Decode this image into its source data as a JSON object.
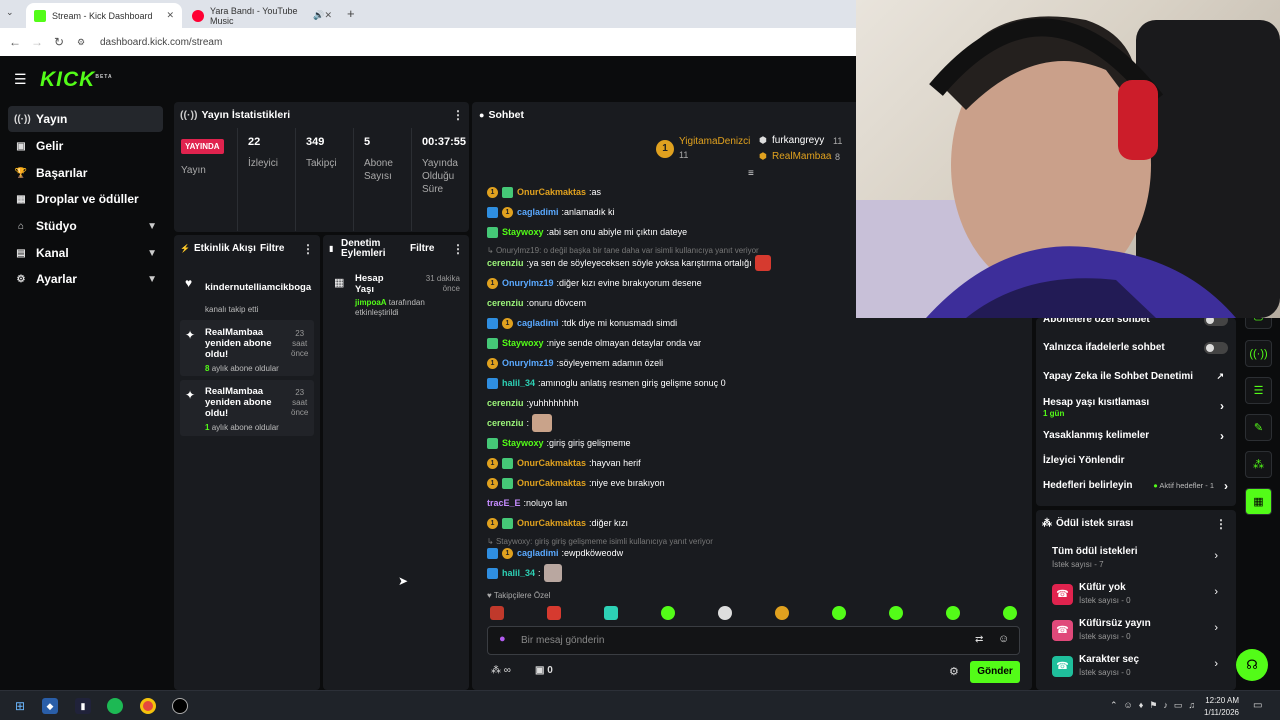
{
  "browser": {
    "tabs": [
      {
        "title": "Stream - Kick Dashboard",
        "favicon_color": "#53fc18"
      },
      {
        "title": "Yara Bandı - YouTube Music",
        "favicon_color": "#ff0033"
      }
    ],
    "url": "dashboard.kick.com/stream"
  },
  "app": {
    "logo": "KICK",
    "logo_tag": "BETA"
  },
  "sidebar": {
    "items": [
      {
        "label": "Yayın",
        "icon": "broadcast-icon"
      },
      {
        "label": "Gelir",
        "icon": "dollar-icon"
      },
      {
        "label": "Başarılar",
        "icon": "trophy-icon"
      },
      {
        "label": "Droplar ve ödüller",
        "icon": "gift-icon"
      },
      {
        "label": "Stüdyo",
        "icon": "studio-icon"
      },
      {
        "label": "Kanal",
        "icon": "channel-icon"
      },
      {
        "label": "Ayarlar",
        "icon": "gear-icon"
      }
    ]
  },
  "stats": {
    "title": "Yayın İstatistikleri",
    "live_badge": "YAYINDA",
    "status_label": "Yayın",
    "viewers": {
      "value": "22",
      "label": "İzleyici"
    },
    "followers": {
      "value": "349",
      "label": "Takipçi"
    },
    "subs": {
      "value": "5",
      "label1": "Abone",
      "label2": "Sayısı"
    },
    "duration": {
      "value": "00:37:55",
      "label1": "Yayında",
      "label2": "Olduğu",
      "label3": "Süre"
    }
  },
  "activity": {
    "title": "Etkinlik Akışı",
    "filter": "Filtre",
    "items": [
      {
        "name": "kindernutelliamcikboga",
        "desc": "kanalı takip etti"
      },
      {
        "name1": "RealMambaa",
        "name2": "yeniden abone",
        "name3": "oldu!",
        "time1": "23",
        "time2": "saat",
        "time3": "önce",
        "count": "8",
        "desc": "aylık abone oldular"
      },
      {
        "name1": "RealMambaa",
        "name2": "yeniden abone",
        "name3": "oldu!",
        "time1": "23",
        "time2": "saat",
        "time3": "önce",
        "count": "1",
        "desc": "aylık abone oldular"
      }
    ]
  },
  "moderation": {
    "title1": "Denetim",
    "title2": "Eylemleri",
    "filter": "Filtre",
    "item": {
      "name1": "Hesap",
      "name2": "Yaşı",
      "time1": "31 dakika",
      "time2": "önce",
      "actor": "jimpoaA",
      "desc1": "tarafından",
      "desc2": "etkinleştirildi"
    }
  },
  "chat": {
    "title": "Sohbet",
    "pinned": [
      {
        "name": "YigitamaDenizci",
        "count": "11"
      },
      {
        "name": "furkangreyy",
        "count": "11"
      },
      {
        "name": "RealMambaa",
        "count": "8"
      }
    ],
    "messages": [
      {
        "user": "OnurCakmaktas",
        "text": "as"
      },
      {
        "user": "cagladimi",
        "text": "anlamadık ki"
      },
      {
        "user": "Staywoxy",
        "text": "abi sen onu abiyle mi çıktın dateye"
      },
      {
        "reply": "Onurylmz19: o değil başka bir tane daha var isimli kullanıcıya yanıt veriyor"
      },
      {
        "user": "cerenziu",
        "text": "ya sen de söyleyeceksen söyle yoksa karıştırma ortalığı"
      },
      {
        "user": "Onurylmz19",
        "text": "diğer kızı evine bırakıyorum desene"
      },
      {
        "user": "cerenziu",
        "text": "onuru dövcem"
      },
      {
        "user": "cagladimi",
        "text": "tdk diye mi konusmadı simdi"
      },
      {
        "user": "Staywoxy",
        "text": "niye sende olmayan detaylar onda var"
      },
      {
        "user": "Onurylmz19",
        "text": "söyleyemem adamın özeli"
      },
      {
        "user": "halil_34",
        "text": "amınoglu anlatış resmen giriş gelişme sonuç 0"
      },
      {
        "user": "cerenziu",
        "text": "yuhhhhhhhh"
      },
      {
        "user": "cerenziu",
        "text": ""
      },
      {
        "user": "Staywoxy",
        "text": "giriş giriş gelişmeme"
      },
      {
        "user": "OnurCakmaktas",
        "text": "hayvan herif"
      },
      {
        "user": "OnurCakmaktas",
        "text": "niye eve bırakıyon"
      },
      {
        "user": "tracE_E",
        "text": "noluyo lan"
      },
      {
        "user": "OnurCakmaktas",
        "text": "diğer kızı"
      },
      {
        "reply": "Staywoxy: giriş giriş gelişmeme isimli kullanıcıya yanıt veriyor"
      },
      {
        "user": "cagladimi",
        "text": "ewpdköweodw"
      },
      {
        "user": "halil_34",
        "text": ""
      }
    ],
    "followers_only": "Takipçilere Özel",
    "input_placeholder": "Bir mesaj gönderin",
    "points": "∞",
    "gifts": "0",
    "send": "Gönder"
  },
  "settings": {
    "rows": [
      {
        "label": "Abonelere özel sohbet"
      },
      {
        "label": "Yalnızca ifadelerle sohbet"
      },
      {
        "label": "Yapay Zeka ile Sohbet Denetimi"
      },
      {
        "label": "Hesap yaşı kısıtlaması",
        "sub": "1 gün"
      },
      {
        "label": "Yasaklanmış kelimeler"
      },
      {
        "label": "İzleyici Yönlendir"
      },
      {
        "label": "Hedefleri belirleyin",
        "status": "Aktif hedefler - 1"
      }
    ]
  },
  "rewards": {
    "title": "Ödül istek sırası",
    "items": [
      {
        "title": "Tüm ödül istekleri",
        "sub": "İstek sayısı - 7"
      },
      {
        "title": "Küfür yok",
        "sub": "İstek sayısı - 0",
        "color": "#e0234e"
      },
      {
        "title": "Küfürsüz yayın",
        "sub": "İstek sayısı - 0",
        "color": "#e0497a"
      },
      {
        "title": "Karakter seç",
        "sub": "İstek sayısı - 0",
        "color": "#1fbf9c"
      }
    ]
  },
  "taskbar": {
    "time": "12:20 AM",
    "date": "1/11/2026"
  },
  "colors": {
    "accent": "#53fc18",
    "live": "#e0234e"
  }
}
